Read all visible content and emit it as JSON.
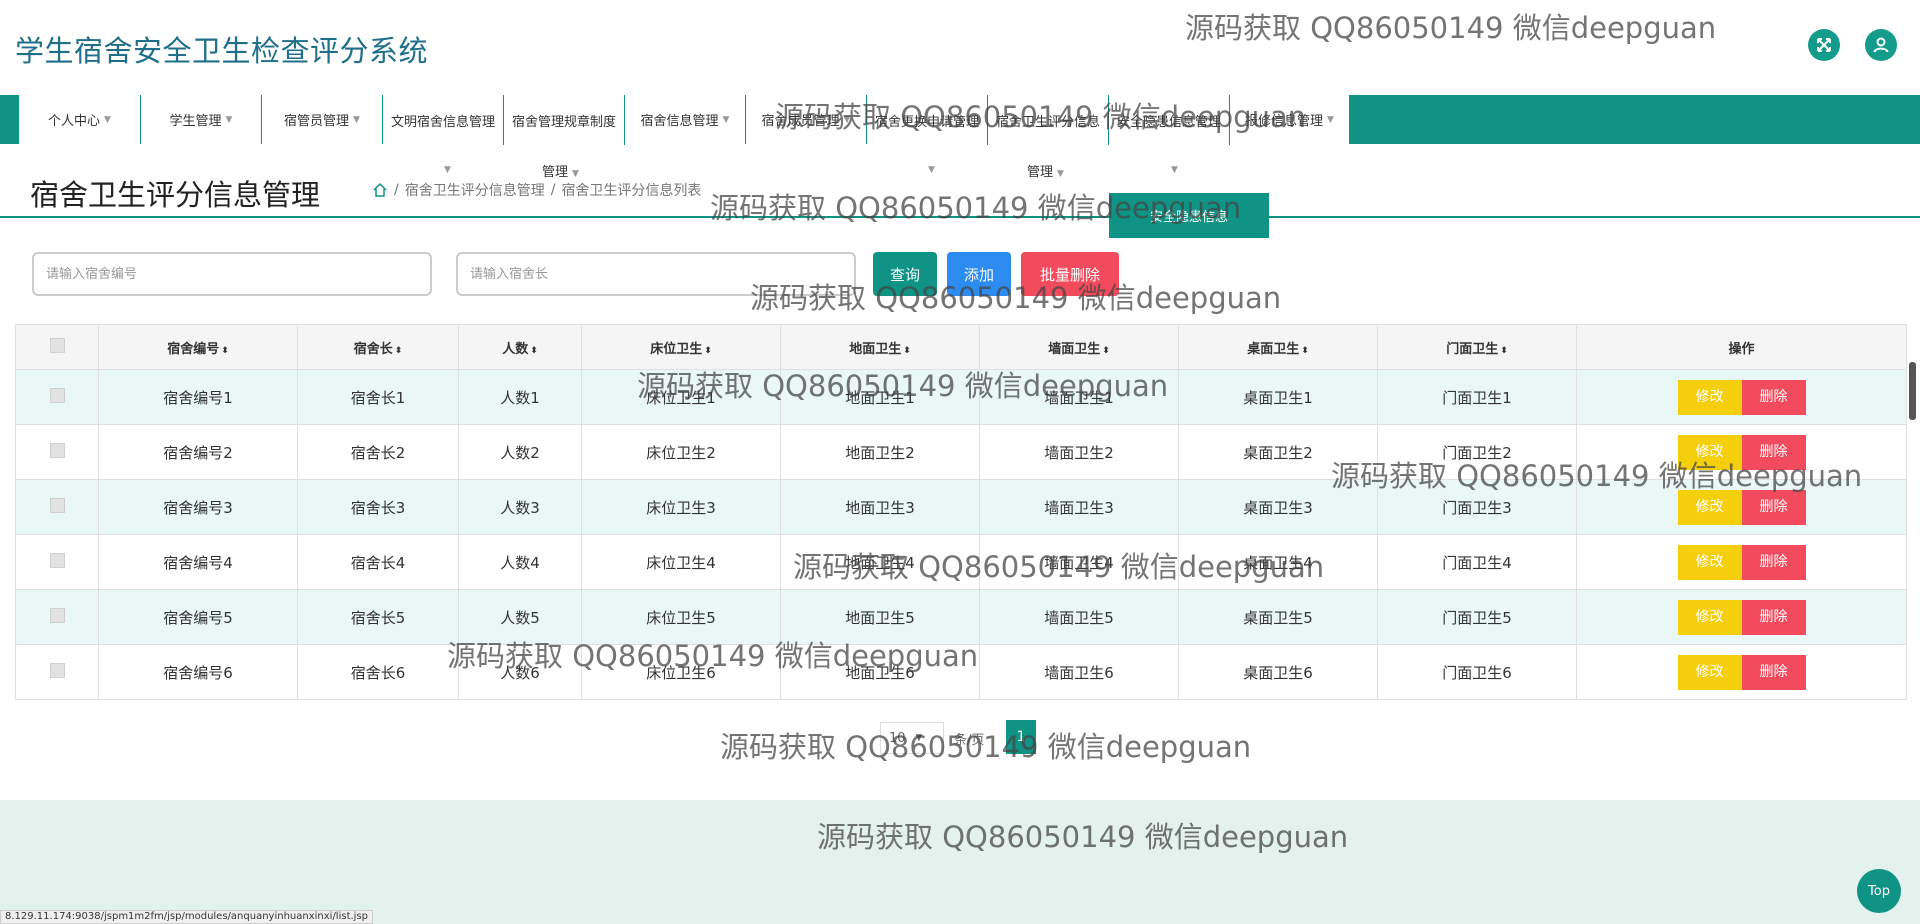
{
  "header": {
    "app_title": "学生宿舍安全卫生检查评分系统"
  },
  "icons": {
    "fullscreen": "fullscreen-icon",
    "user": "user-icon",
    "home": "home-icon"
  },
  "colors": {
    "primary": "#0f9384",
    "edit": "#f5cf0c",
    "delete": "#f24b5d",
    "add": "#2d8cf0"
  },
  "nav": {
    "items": [
      "个人中心",
      "学生管理",
      "宿管员管理",
      "文明宿舍信息管理",
      "宿舍管理规章制度",
      "宿舍信息管理",
      "宿舍成员管理",
      "宿舍更换申请管理",
      "宿舍卫生评分信息",
      "安全隐患信息管理",
      "报修信息管理"
    ],
    "sub_label": "管理"
  },
  "page": {
    "heading": "宿舍卫生评分信息管理",
    "breadcrumb_1": "宿舍卫生评分信息管理",
    "breadcrumb_sep": "/",
    "breadcrumb_2": "宿舍卫生评分信息列表",
    "dropdown_popup": "安全隐患信息"
  },
  "search": {
    "dorm_no_placeholder": "请输入宿舍编号",
    "dorm_head_placeholder": "请输入宿舍长",
    "query_label": "查询",
    "add_label": "添加",
    "batch_delete_label": "批量删除"
  },
  "table": {
    "columns": [
      "宿舍编号",
      "宿舍长",
      "人数",
      "床位卫生",
      "地面卫生",
      "墙面卫生",
      "桌面卫生",
      "门面卫生",
      "操作"
    ],
    "edit_label": "修改",
    "delete_label": "删除",
    "rows": [
      [
        "宿舍编号1",
        "宿舍长1",
        "人数1",
        "床位卫生1",
        "地面卫生1",
        "墙面卫生1",
        "桌面卫生1",
        "门面卫生1"
      ],
      [
        "宿舍编号2",
        "宿舍长2",
        "人数2",
        "床位卫生2",
        "地面卫生2",
        "墙面卫生2",
        "桌面卫生2",
        "门面卫生2"
      ],
      [
        "宿舍编号3",
        "宿舍长3",
        "人数3",
        "床位卫生3",
        "地面卫生3",
        "墙面卫生3",
        "桌面卫生3",
        "门面卫生3"
      ],
      [
        "宿舍编号4",
        "宿舍长4",
        "人数4",
        "床位卫生4",
        "地面卫生4",
        "墙面卫生4",
        "桌面卫生4",
        "门面卫生4"
      ],
      [
        "宿舍编号5",
        "宿舍长5",
        "人数5",
        "床位卫生5",
        "地面卫生5",
        "墙面卫生5",
        "桌面卫生5",
        "门面卫生5"
      ],
      [
        "宿舍编号6",
        "宿舍长6",
        "人数6",
        "床位卫生6",
        "地面卫生6",
        "墙面卫生6",
        "桌面卫生6",
        "门面卫生6"
      ]
    ]
  },
  "pager": {
    "page_size": "10",
    "page_size_suffix": "条/页",
    "current_page": "1"
  },
  "footer": {
    "top_label": "Top"
  },
  "status_url": "8.129.11.174:9038/jspm1m2fm/jsp/modules/anquanyinhuanxinxi/list.jsp",
  "watermark": "源码获取 QQ86050149 微信deepguan"
}
